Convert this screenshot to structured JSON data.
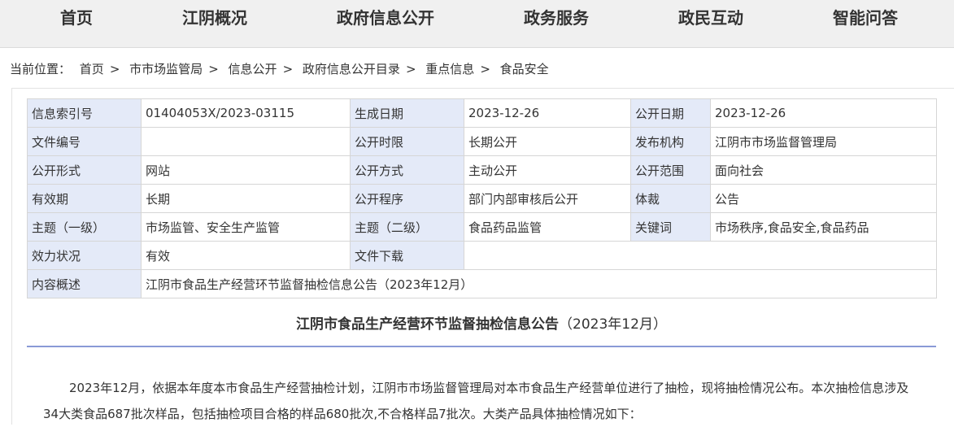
{
  "nav": {
    "items": [
      "首页",
      "江阴概况",
      "政府信息公开",
      "政务服务",
      "政民互动",
      "智能问答"
    ]
  },
  "breadcrumb": {
    "prefix": "当前位置：",
    "items": [
      "首页",
      "市市场监管局",
      "信息公开",
      "政府信息公开目录",
      "重点信息",
      "食品安全"
    ],
    "separator": ">"
  },
  "meta": {
    "rows": [
      [
        {
          "k": "信息索引号",
          "v": "01404053X/2023-03115"
        },
        {
          "k": "生成日期",
          "v": "2023-12-26"
        },
        {
          "k": "公开日期",
          "v": "2023-12-26"
        }
      ],
      [
        {
          "k": "文件编号",
          "v": ""
        },
        {
          "k": "公开时限",
          "v": "长期公开"
        },
        {
          "k": "发布机构",
          "v": "江阴市市场监督管理局"
        }
      ],
      [
        {
          "k": "公开形式",
          "v": "网站"
        },
        {
          "k": "公开方式",
          "v": "主动公开"
        },
        {
          "k": "公开范围",
          "v": "面向社会"
        }
      ],
      [
        {
          "k": "有效期",
          "v": "长期"
        },
        {
          "k": "公开程序",
          "v": "部门内部审核后公开"
        },
        {
          "k": "体裁",
          "v": "公告"
        }
      ],
      [
        {
          "k": "主题（一级）",
          "v": "市场监管、安全生产监管"
        },
        {
          "k": "主题（二级）",
          "v": "食品药品监管"
        },
        {
          "k": "关键词",
          "v": "市场秩序,食品安全,食品药品"
        }
      ]
    ],
    "validity_label": "效力状况",
    "validity_value": "有效",
    "download_label": "文件下载",
    "summary_label": "内容概述",
    "summary_value": "江阴市食品生产经营环节监督抽检信息公告（2023年12月）"
  },
  "article": {
    "title": "江阴市食品生产经营环节监督抽检信息公告",
    "title_suffix": "（2023年12月）",
    "paragraph": "2023年12月，依据本年度本市食品生产经营抽检计划，江阴市市场监督管理局对本市食品生产经营单位进行了抽检，现将抽检情况公布。本次抽检信息涉及34大类食品687批次样品，包括抽检项目合格的样品680批次,不合格样品7批次。大类产品具体抽检情况如下："
  }
}
